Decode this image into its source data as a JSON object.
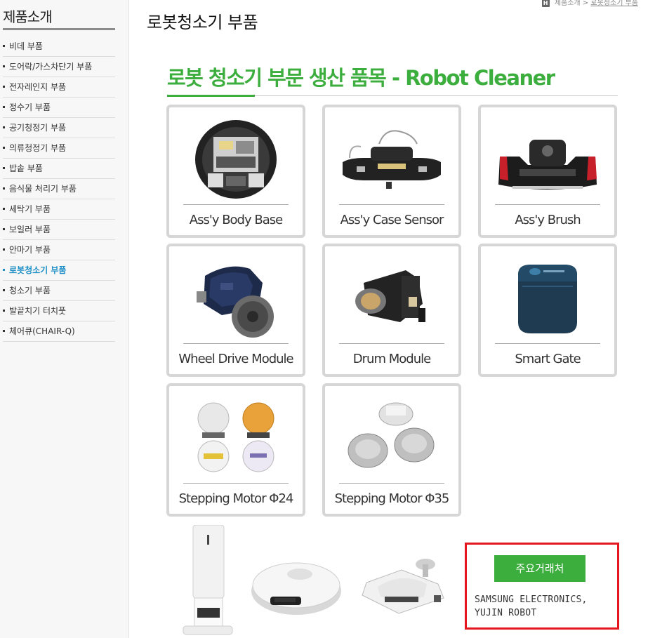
{
  "sidebar": {
    "title": "제품소개",
    "items": [
      {
        "label": "비데 부품",
        "active": false
      },
      {
        "label": "도어락/가스차단기 부품",
        "active": false
      },
      {
        "label": "전자레인지 부품",
        "active": false
      },
      {
        "label": "정수기 부품",
        "active": false
      },
      {
        "label": "공기청정기 부품",
        "active": false
      },
      {
        "label": "의류청정기 부품",
        "active": false
      },
      {
        "label": "밥솥 부품",
        "active": false
      },
      {
        "label": "음식물 처리기 부품",
        "active": false
      },
      {
        "label": "세탁기 부품",
        "active": false
      },
      {
        "label": "보일러 부품",
        "active": false
      },
      {
        "label": "안마기 부품",
        "active": false
      },
      {
        "label": "로봇청소기 부품",
        "active": true
      },
      {
        "label": "청소기 부품",
        "active": false
      },
      {
        "label": "발끝치기 터치풋",
        "active": false
      },
      {
        "label": "체어큐(CHAIR-Q)",
        "active": false
      }
    ]
  },
  "breadcrumb": {
    "home_icon": "home-icon",
    "parent": "제품소개",
    "separator": ">",
    "current": "로봇청소기 부품"
  },
  "page_title": "로봇청소기 부품",
  "section": {
    "title": "로봇 청소기 부문 생산 품목 - Robot Cleaner"
  },
  "products": [
    {
      "name": "Ass'y Body Base"
    },
    {
      "name": "Ass'y Case Sensor"
    },
    {
      "name": "Ass'y Brush"
    },
    {
      "name": "Wheel Drive Module"
    },
    {
      "name": "Drum Module"
    },
    {
      "name": "Smart Gate"
    },
    {
      "name": "Stepping Motor Φ24"
    },
    {
      "name": "Stepping Motor Φ35"
    }
  ],
  "client": {
    "button_label": "주요거래처",
    "line1": "SAMSUNG ELECTRONICS,",
    "line2": "YUJIN ROBOT"
  },
  "colors": {
    "accent_green": "#3cae3e",
    "active_blue": "#1e8fc6",
    "client_border_red": "#e4161e"
  }
}
